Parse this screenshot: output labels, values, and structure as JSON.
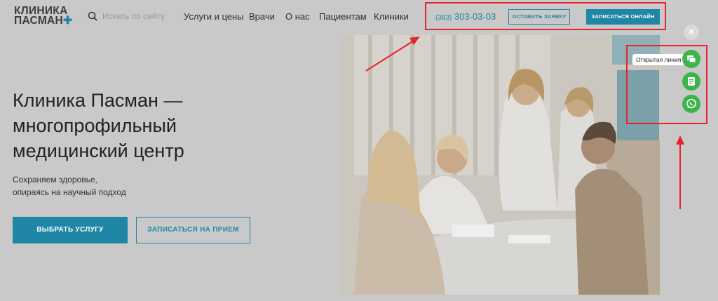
{
  "logo": {
    "line1": "КЛИНИКА",
    "line2": "ПАСМАН",
    "plus": "✚"
  },
  "search": {
    "placeholder": "Искать по сайту"
  },
  "nav": {
    "items": [
      "Услуги и цены",
      "Врачи",
      "О нас",
      "Пациентам",
      "Клиники"
    ]
  },
  "header": {
    "phone_code": "(383)",
    "phone_number": "303-03-03",
    "request_button": "ОСТАВИТЬ ЗАЯВКУ",
    "online_button": "ЗАПИСАТЬСЯ ОНЛАЙН"
  },
  "hero": {
    "title_line1": "Клиника Пасман —",
    "title_line2": "многопрофильный",
    "title_line3": "медицинский центр",
    "subtitle_line1": "Сохраняем здоровье,",
    "subtitle_line2": "опираясь на научный подход",
    "primary_button": "ВЫБРАТЬ УСЛУГУ",
    "secondary_button": "ЗАПИСАТЬСЯ НА ПРИЕМ"
  },
  "widget": {
    "close_icon": "×",
    "tooltip": "Открытая линия",
    "icons": [
      "chat-icon",
      "form-icon",
      "whatsapp-icon"
    ]
  },
  "colors": {
    "accent": "#1f86a6",
    "annotation": "#e8232a",
    "widget_green": "#3bb44a"
  }
}
